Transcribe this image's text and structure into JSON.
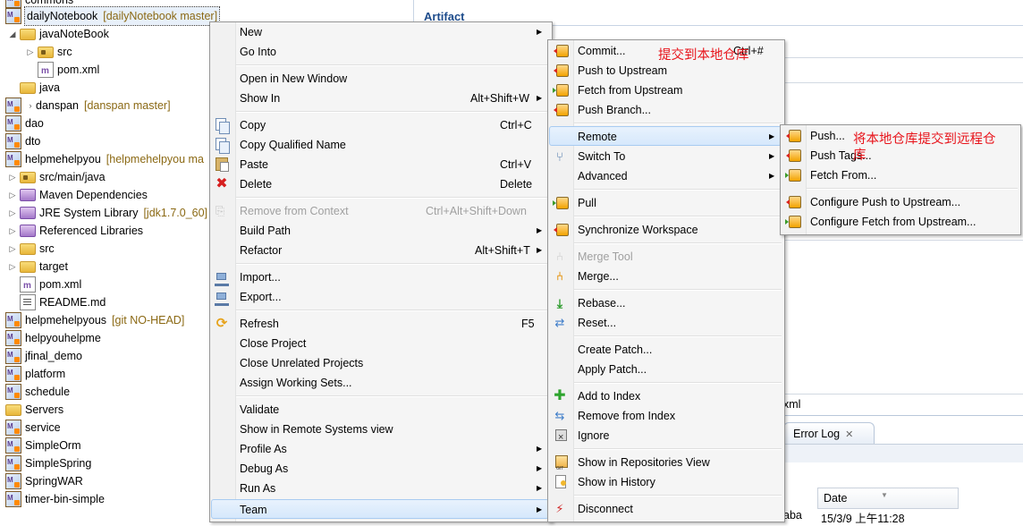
{
  "explorer": {
    "rows": [
      {
        "label": "commons",
        "deco": ""
      },
      {
        "label": "dailyNotebook",
        "deco": "[dailyNotebook master]"
      },
      {
        "label": "javaNoteBook",
        "deco": ""
      },
      {
        "label": "src",
        "deco": ""
      },
      {
        "label": "pom.xml",
        "deco": ""
      },
      {
        "label": "java",
        "deco": ""
      },
      {
        "label": "danspan",
        "deco": "[danspan master]"
      },
      {
        "label": "dao",
        "deco": ""
      },
      {
        "label": "dto",
        "deco": ""
      },
      {
        "label": "helpmehelpyou",
        "deco": "[helpmehelpyou ma"
      },
      {
        "label": "src/main/java",
        "deco": ""
      },
      {
        "label": "Maven Dependencies",
        "deco": ""
      },
      {
        "label": "JRE System Library",
        "deco": "[jdk1.7.0_60]"
      },
      {
        "label": "Referenced Libraries",
        "deco": ""
      },
      {
        "label": "src",
        "deco": ""
      },
      {
        "label": "target",
        "deco": ""
      },
      {
        "label": "pom.xml",
        "deco": ""
      },
      {
        "label": "README.md",
        "deco": ""
      },
      {
        "label": "helpmehelpyous",
        "deco": "[git NO-HEAD]"
      },
      {
        "label": "helpyouhelpme",
        "deco": ""
      },
      {
        "label": "jfinal_demo",
        "deco": ""
      },
      {
        "label": "platform",
        "deco": ""
      },
      {
        "label": "schedule",
        "deco": ""
      },
      {
        "label": "Servers",
        "deco": ""
      },
      {
        "label": "service",
        "deco": ""
      },
      {
        "label": "SimpleOrm",
        "deco": ""
      },
      {
        "label": "SimpleSpring",
        "deco": ""
      },
      {
        "label": "SpringWAR",
        "deco": ""
      },
      {
        "label": "timer-bin-simple",
        "deco": ""
      }
    ]
  },
  "editor": {
    "artifact_title": "Artifact",
    "xml_tab": "xml",
    "error_log_tab": "Error Log",
    "date_header": "Date",
    "date_value": "15/3/9 上午11:28",
    "cut_value": "aba"
  },
  "main_menu": {
    "items": [
      {
        "label": "New",
        "accel": "",
        "sub": true
      },
      {
        "label": "Go Into",
        "accel": ""
      },
      {
        "label": "Open in New Window",
        "accel": ""
      },
      {
        "label": "Show In",
        "accel": "Alt+Shift+W",
        "sub": true
      },
      {
        "label": "Copy",
        "accel": "Ctrl+C"
      },
      {
        "label": "Copy Qualified Name",
        "accel": ""
      },
      {
        "label": "Paste",
        "accel": "Ctrl+V"
      },
      {
        "label": "Delete",
        "accel": "Delete"
      },
      {
        "label": "Remove from Context",
        "accel": "Ctrl+Alt+Shift+Down"
      },
      {
        "label": "Build Path",
        "accel": "",
        "sub": true
      },
      {
        "label": "Refactor",
        "accel": "Alt+Shift+T",
        "sub": true
      },
      {
        "label": "Import...",
        "accel": ""
      },
      {
        "label": "Export...",
        "accel": ""
      },
      {
        "label": "Refresh",
        "accel": "F5"
      },
      {
        "label": "Close Project",
        "accel": ""
      },
      {
        "label": "Close Unrelated Projects",
        "accel": ""
      },
      {
        "label": "Assign Working Sets...",
        "accel": ""
      },
      {
        "label": "Validate",
        "accel": ""
      },
      {
        "label": "Show in Remote Systems view",
        "accel": ""
      },
      {
        "label": "Profile As",
        "accel": "",
        "sub": true
      },
      {
        "label": "Debug As",
        "accel": "",
        "sub": true
      },
      {
        "label": "Run As",
        "accel": "",
        "sub": true
      },
      {
        "label": "Team",
        "accel": "",
        "sub": true
      }
    ]
  },
  "team_menu": {
    "items": [
      {
        "label": "Commit...",
        "accel": "Ctrl+#"
      },
      {
        "label": "Push to Upstream"
      },
      {
        "label": "Fetch from Upstream"
      },
      {
        "label": "Push Branch..."
      },
      {
        "label": "Remote",
        "sub": true
      },
      {
        "label": "Switch To",
        "sub": true
      },
      {
        "label": "Advanced",
        "sub": true
      },
      {
        "label": "Pull"
      },
      {
        "label": "Synchronize Workspace"
      },
      {
        "label": "Merge Tool"
      },
      {
        "label": "Merge..."
      },
      {
        "label": "Rebase..."
      },
      {
        "label": "Reset..."
      },
      {
        "label": "Create Patch..."
      },
      {
        "label": "Apply Patch..."
      },
      {
        "label": "Add to Index"
      },
      {
        "label": "Remove from Index"
      },
      {
        "label": "Ignore"
      },
      {
        "label": "Show in Repositories View"
      },
      {
        "label": "Show in History"
      },
      {
        "label": "Disconnect"
      }
    ]
  },
  "remote_menu": {
    "items": [
      {
        "label": "Push..."
      },
      {
        "label": "Push Tags..."
      },
      {
        "label": "Fetch From..."
      },
      {
        "label": "Configure Push to Upstream..."
      },
      {
        "label": "Configure Fetch from Upstream..."
      }
    ]
  },
  "annotations": {
    "commit_note": "提交到本地仓库",
    "push_note_line1": "将本地仓库提交到远程仓",
    "push_note_line2": "库"
  }
}
